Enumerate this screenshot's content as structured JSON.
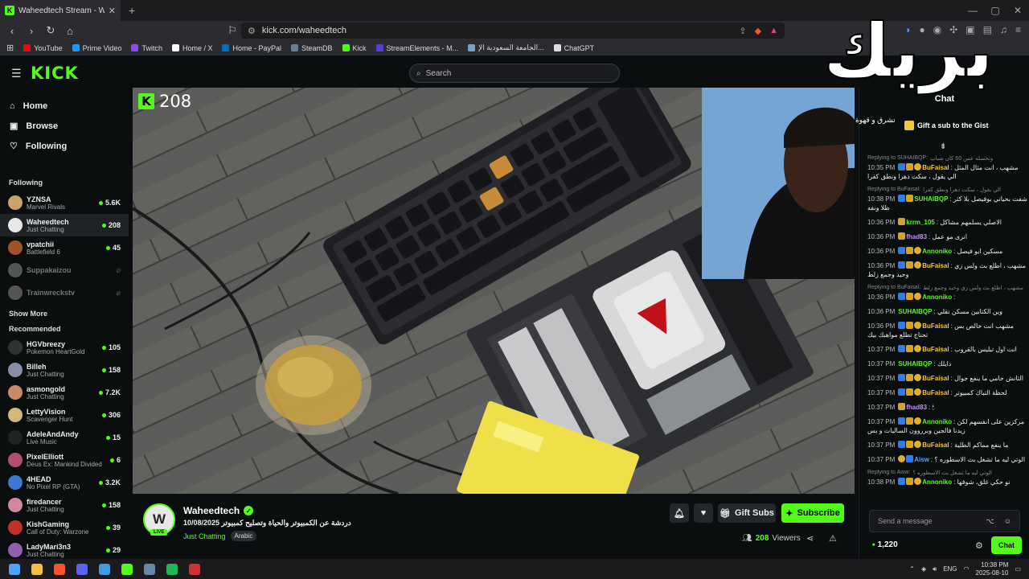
{
  "browser": {
    "tab_title": "Waheedtech Stream - Watch",
    "url": "kick.com/waheedtech",
    "bookmarks": [
      "YouTube",
      "Prime Video",
      "Twitch",
      "Home / X",
      "Home - PayPal",
      "SteamDB",
      "Kick",
      "StreamElements - M...",
      "الجامعة السعودية الإ...",
      "ChatGPT"
    ],
    "bookmark_colors": [
      "#ff0000",
      "#1a98ff",
      "#9146ff",
      "#ffffff",
      "#0070ba",
      "#6b7c93",
      "#53fc18",
      "#5a3de0",
      "#7aa0c8",
      "#dddddd"
    ]
  },
  "kick": {
    "logo": "KICK",
    "search_placeholder": "Search"
  },
  "sidebar": {
    "nav": [
      {
        "label": "Home",
        "icon": "home-icon"
      },
      {
        "label": "Browse",
        "icon": "browse-icon"
      },
      {
        "label": "Following",
        "icon": "heart-icon"
      }
    ],
    "following_title": "Following",
    "following": [
      {
        "name": "YZNSA",
        "cat": "Marvel Rivals",
        "viewers": "5.6K",
        "color": "#c9a36a"
      },
      {
        "name": "Waheedtech",
        "cat": "Just Chatting",
        "viewers": "208",
        "color": "#e8e8e8"
      },
      {
        "name": "vpatchii",
        "cat": "Battlefield 6",
        "viewers": "45",
        "color": "#a0522d"
      },
      {
        "name": "Suppakaizou",
        "cat": "",
        "viewers": "",
        "color": "#555"
      },
      {
        "name": "Trainwreckstv",
        "cat": "",
        "viewers": "",
        "color": "#555"
      }
    ],
    "show_more": "Show More",
    "recommended_title": "Recommended",
    "recommended": [
      {
        "name": "HGVbreezy",
        "cat": "Pokemon HeartGold",
        "viewers": "105",
        "color": "#333"
      },
      {
        "name": "Billeh",
        "cat": "Just Chatting",
        "viewers": "158",
        "color": "#8a8fa8"
      },
      {
        "name": "asmongold",
        "cat": "Just Chatting",
        "viewers": "7.2K",
        "color": "#c98a6a"
      },
      {
        "name": "LettyVision",
        "cat": "Scavenger Hunt",
        "viewers": "306",
        "color": "#d4b878"
      },
      {
        "name": "AdeleAndAndy",
        "cat": "Live Music",
        "viewers": "15",
        "color": "#222"
      },
      {
        "name": "PixelElliott",
        "cat": "Deus Ex: Mankind Divided",
        "viewers": "6",
        "color": "#b05070"
      },
      {
        "name": "4HEAD",
        "cat": "No Pixel RP (GTA)",
        "viewers": "3.2K",
        "color": "#3a7ad0"
      },
      {
        "name": "firedancer",
        "cat": "Just Chatting",
        "viewers": "158",
        "color": "#d08aa0"
      },
      {
        "name": "KishGaming",
        "cat": "Call of Duty: Warzone",
        "viewers": "39",
        "color": "#c23030"
      },
      {
        "name": "LadyMari3n3",
        "cat": "Just Chatting",
        "viewers": "29",
        "color": "#9060b0"
      }
    ]
  },
  "video": {
    "viewer_badge": "208"
  },
  "stream": {
    "avatar_letter": "W",
    "live": "LIVE",
    "name": "Waheedtech",
    "title": "دردشة عن الكمبيوتر والحياة وتصليح كمبيوتر 10/08/2025",
    "category": "Just Chatting",
    "language": "Arabic",
    "gift_subs": "Gift Subs",
    "subscribe": "Subscribe",
    "viewers_count": "208",
    "viewers_label": "Viewers"
  },
  "chat": {
    "overlay_big": "بريك",
    "overlay_small": "تشرق و قهوة",
    "title": "Chat",
    "gift_text": "Gift a sub to the Gist",
    "messages": [
      {
        "reply": "Replying to SUHAIBQP:",
        "reply_text": "وتحسله عس 60 كان شباب",
        "time": "10:35 PM",
        "user": "BuFaisal",
        "ucolor": "#f5c542",
        "badges": [
          "b1",
          "b2",
          "b3"
        ],
        "text": "مشهب ، انت مثال المثل الي يقول ، سكت دهرا ونطق كفرا"
      },
      {
        "reply": "Replying to BuFaisal:",
        "reply_text": "الي يقول ، سكت دهرا ونطق كفرا",
        "time": "10:38 PM",
        "user": "SUHAIBQP",
        "ucolor": "#53fc18",
        "badges": [
          "b1",
          "b2"
        ],
        "text": "شفت بحياتي بوفيصل بلا كثر ظلا ونفه"
      },
      {
        "reply": "",
        "reply_text": "",
        "time": "10:36 PM",
        "user": "krrm_105",
        "ucolor": "#53fc18",
        "badges": [
          "b2"
        ],
        "text": "الاصلي يسلمهم مشاكل"
      },
      {
        "reply": "",
        "reply_text": "",
        "time": "10:36 PM",
        "user": "fhad83",
        "ucolor": "#c48fff",
        "badges": [
          "b2"
        ],
        "text": "انرى مو عمل"
      },
      {
        "reply": "",
        "reply_text": "",
        "time": "10:36 PM",
        "user": "Annoniko",
        "ucolor": "#53fc18",
        "badges": [
          "b1",
          "b2",
          "b3"
        ],
        "text": "مسكين ابو فيصل"
      },
      {
        "reply": "",
        "reply_text": "",
        "time": "10:36 PM",
        "user": "BuFaisal",
        "ucolor": "#f5c542",
        "badges": [
          "b1",
          "b2",
          "b3"
        ],
        "text": "مشهب ، اطلع بث ولس زي وحيد وجمع زلط"
      },
      {
        "reply": "Replying to BuFaisal:",
        "reply_text": "مشهب ، اطلع بث ولس زي وحيد وجمع زلط",
        "time": "10:36 PM",
        "user": "Annoniko",
        "ucolor": "#53fc18",
        "badges": [
          "b1",
          "b2",
          "b3"
        ],
        "text": ""
      },
      {
        "reply": "",
        "reply_text": "",
        "time": "10:36 PM",
        "user": "SUHAIBQP",
        "ucolor": "#53fc18",
        "badges": [],
        "text": "وين الكتابين مسكن نقلي"
      },
      {
        "reply": "",
        "reply_text": "",
        "time": "10:36 PM",
        "user": "BuFaisal",
        "ucolor": "#f5c542",
        "badges": [
          "b1",
          "b2",
          "b3"
        ],
        "text": "مشهب انت خالص بس تحتاج تطلع مواهبك بيك"
      },
      {
        "reply": "",
        "reply_text": "",
        "time": "10:37 PM",
        "user": "BuFaisal",
        "ucolor": "#f5c542",
        "badges": [
          "b1",
          "b2",
          "b3"
        ],
        "text": "انت اول تبليس بالقروب"
      },
      {
        "reply": "",
        "reply_text": "",
        "time": "10:37 PM",
        "user": "SUHAIBQP",
        "ucolor": "#53fc18",
        "badges": [],
        "text": "دايلك"
      },
      {
        "reply": "",
        "reply_text": "",
        "time": "10:37 PM",
        "user": "BuFaisal",
        "ucolor": "#f5c542",
        "badges": [
          "b1",
          "b2",
          "b3"
        ],
        "text": "الثانش حامي ما ينفع جوال"
      },
      {
        "reply": "",
        "reply_text": "",
        "time": "10:37 PM",
        "user": "BuFaisal",
        "ucolor": "#f5c542",
        "badges": [
          "b1",
          "b2",
          "b3"
        ],
        "text": "لحظة التباك كمبيوتر"
      },
      {
        "reply": "",
        "reply_text": "",
        "time": "10:37 PM",
        "user": "fhad83",
        "ucolor": "#c48fff",
        "badges": [
          "b2"
        ],
        "text": "🕯"
      },
      {
        "reply": "",
        "reply_text": "",
        "time": "10:37 PM",
        "user": "Annoniko",
        "ucolor": "#53fc18",
        "badges": [
          "b1",
          "b2",
          "b3"
        ],
        "text": "مركزين على انفسهم لكن زيدنا فالجين وبرروون الساليات و بس"
      },
      {
        "reply": "",
        "reply_text": "",
        "time": "10:37 PM",
        "user": "BuFaisal",
        "ucolor": "#f5c542",
        "badges": [
          "b1",
          "b2",
          "b3"
        ],
        "text": "ما ينفع مماكم الطلية"
      },
      {
        "reply": "",
        "reply_text": "",
        "time": "10:37 PM",
        "user": "Aisw",
        "ucolor": "#5aa0ff",
        "badges": [
          "b3",
          "b1"
        ],
        "text": "الوتي ليه ما تشغل بث الاسطوره ؟"
      },
      {
        "reply": "Replying to Aisw:",
        "reply_text": "الوتي ليه ما تشغل بث الاسطوره ؟",
        "time": "10:38 PM",
        "user": "Annoniko",
        "ucolor": "#53fc18",
        "badges": [
          "b1",
          "b2",
          "b3"
        ],
        "text": "نو حكي غلق، شوفها"
      }
    ],
    "send_placeholder": "Send a message",
    "points": "1,220",
    "chat_button": "Chat"
  },
  "taskbar": {
    "icons": [
      "windows-icon",
      "files-icon",
      "brave-icon",
      "discord-icon",
      "chrome-icon",
      "kick-icon",
      "steam-icon",
      "spotify-icon",
      "app-icon"
    ],
    "icon_colors": [
      "#4aa3ff",
      "#f0c040",
      "#fb542b",
      "#5865f2",
      "#3f9ae0",
      "#53fc18",
      "#6688aa",
      "#1db954",
      "#cc3333"
    ],
    "lang": "ENG",
    "time": "10:38 PM",
    "date": "2025-08-10"
  }
}
